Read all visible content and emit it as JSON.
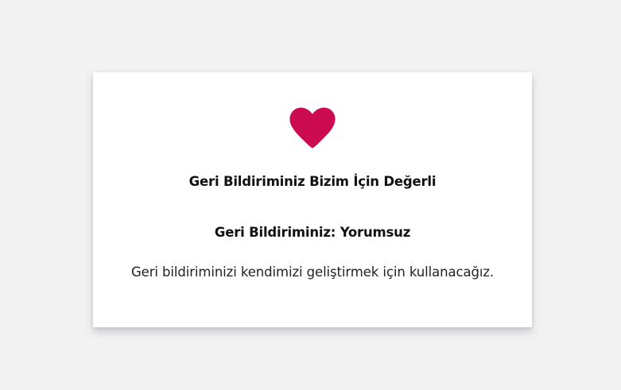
{
  "card": {
    "icon": "heart-icon",
    "icon_color": "#cc0a4f",
    "title": "Geri Bildiriminiz Bizim İçin Değerli",
    "feedback_status": "Geri Bildiriminiz: Yorumsuz",
    "description": "Geri bildiriminizi kendimizi geliştirmek için kullanacağız."
  }
}
